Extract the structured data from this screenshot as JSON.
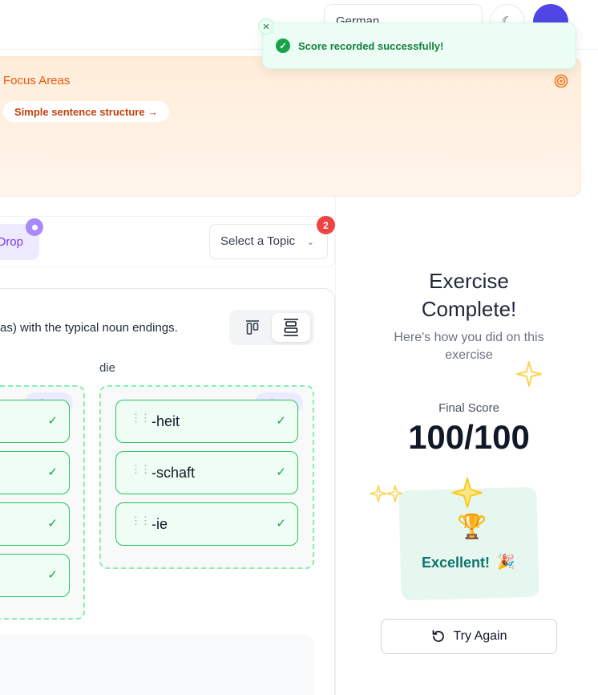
{
  "header": {
    "language": "German",
    "theme_icon": "moon-icon",
    "avatar_icon": "user-avatar"
  },
  "toast": {
    "message": "Score recorded successfully!",
    "close_icon": "close-icon",
    "check_icon": "check-circle-icon"
  },
  "focus": {
    "title": "Focus Areas",
    "chip": "Simple sentence structure →",
    "icon": "target-icon"
  },
  "toolbar": {
    "mode_label": "Drop",
    "topic_placeholder": "Select a Topic",
    "topic_badge": "2"
  },
  "exercise": {
    "instruction": "as) with the typical noun endings.",
    "columns": [
      {
        "label": "",
        "count": "4 items",
        "items": []
      },
      {
        "label": "die",
        "count": "3 items",
        "items": [
          "-heit",
          "-schaft",
          "-ie"
        ]
      }
    ]
  },
  "result": {
    "title": "Exercise Complete!",
    "subtitle": "Here's how you did on this exercise",
    "score_label": "Final Score",
    "score": "100/100",
    "rating": "Excellent!",
    "trophy": "🏆",
    "party": "🎉",
    "try_again": "Try Again"
  },
  "colors": {
    "accent_green": "#16a34a",
    "accent_purple": "#7c3aed",
    "focus_orange": "#ea580c",
    "badge_red": "#ef4444"
  }
}
